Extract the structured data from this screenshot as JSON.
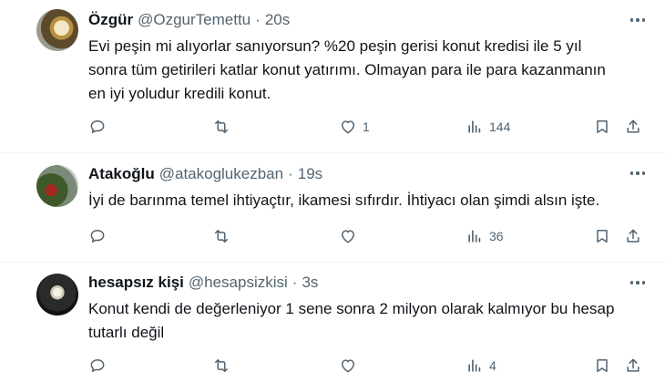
{
  "tweets": [
    {
      "name": "Özgür",
      "handle": "@OzgurTemettu",
      "time": "20s",
      "text": "Evi peşin mi alıyorlar sanıyorsun? %20 peşin gerisi konut kredisi ile 5 yıl\nsonra tüm getirileri katlar konut yatırımı. Olmayan para ile para kazanmanın\nen iyi yoludur kredili konut.",
      "replies": "",
      "retweets": "",
      "likes": "1",
      "views": "144"
    },
    {
      "name": "Atakoğlu",
      "handle": "@atakoglukezban",
      "time": "19s",
      "text": "İyi de barınma temel ihtiyaçtır, ikamesi sıfırdır. İhtiyacı olan şimdi alsın işte.",
      "replies": "",
      "retweets": "",
      "likes": "",
      "views": "36"
    },
    {
      "name": "hesapsız kişi",
      "handle": "@hesapsizkisi",
      "time": "3s",
      "text": "Konut kendi de değerleniyor 1 sene sonra 2 milyon olarak kalmıyor bu hesap\ntutarlı değil",
      "replies": "",
      "retweets": "",
      "likes": "",
      "views": "4"
    }
  ],
  "dot": "·",
  "icons": [
    "reply-icon",
    "retweet-icon",
    "like-icon",
    "views-icon",
    "bookmark-icon",
    "share-icon",
    "more-icon"
  ]
}
